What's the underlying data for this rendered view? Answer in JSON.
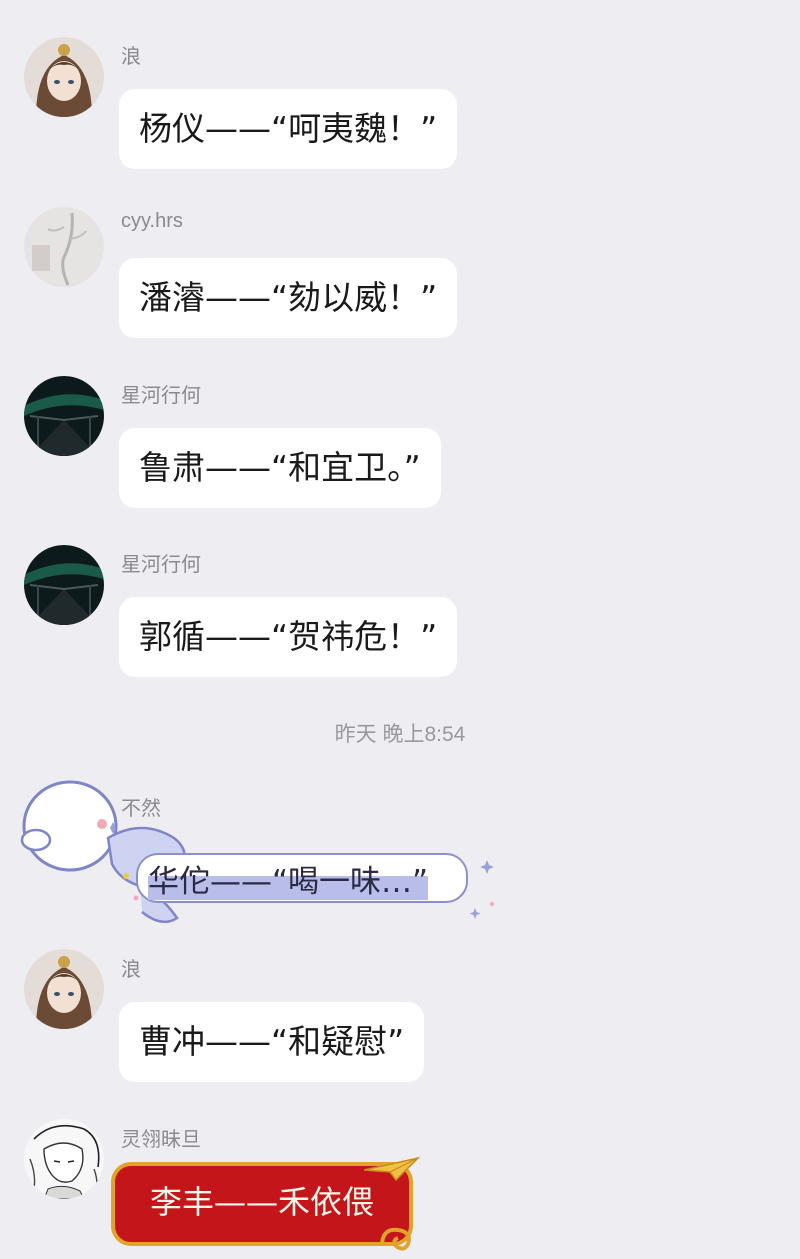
{
  "colors": {
    "background": "#ededf2",
    "bubble": "#ffffff",
    "name_text": "#8a8a8f",
    "red_bubble": "#c4151b",
    "gold_border": "#e2a32a"
  },
  "messages": [
    {
      "sender": "浪",
      "avatar": "anime-girl-avatar",
      "text": "杨仪——“呵夷魏！”"
    },
    {
      "sender": "cyy.hrs",
      "avatar": "sketch-avatar",
      "text": "潘濬——“劾以威！”"
    },
    {
      "sender": "星河行何",
      "avatar": "night-bridge-avatar",
      "text": "鲁肃——“和宜卫。”"
    },
    {
      "sender": "星河行何",
      "avatar": "night-bridge-avatar",
      "text": "郭循——“贺祎危！”"
    },
    {
      "sender": "不然",
      "avatar": "cartoon-seal-avatar",
      "text": "华佗——“喝一味…”"
    },
    {
      "sender": "浪",
      "avatar": "anime-girl-avatar",
      "text": "曹冲——“和疑慰”"
    },
    {
      "sender": "灵翎昧旦",
      "avatar": "line-art-avatar",
      "text": "李丰——禾依偎"
    }
  ],
  "timestamp": "昨天 晚上8:54"
}
